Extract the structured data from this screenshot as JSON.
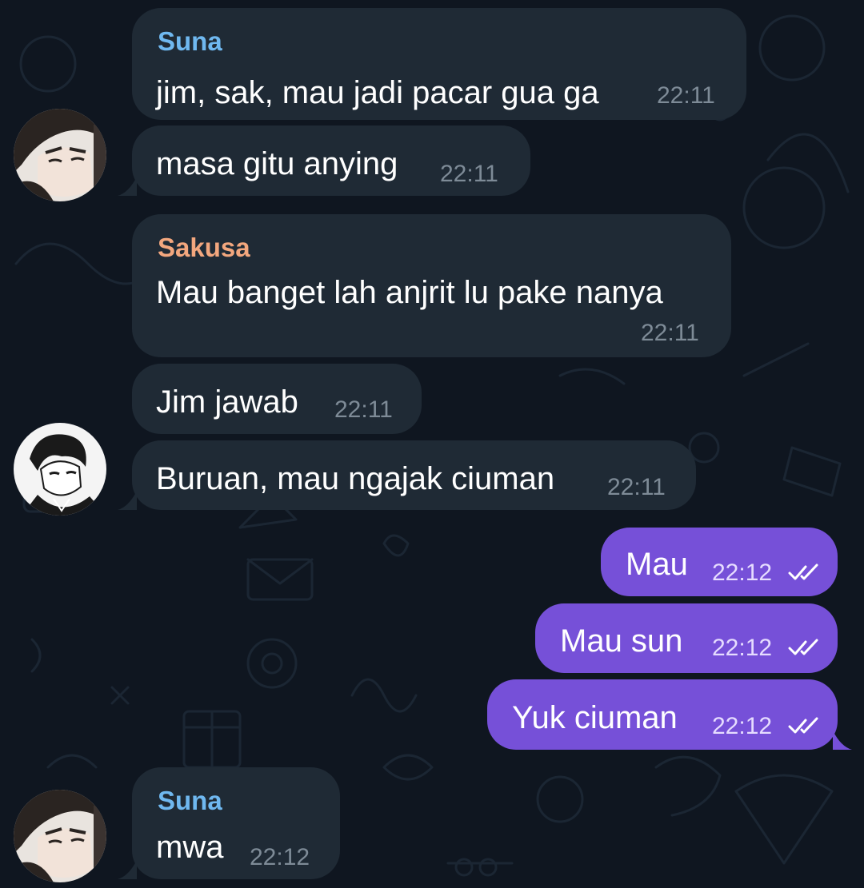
{
  "colors": {
    "background": "#0f1620",
    "incoming_bubble": "#1f2a35",
    "outgoing_bubble": "#7650d8",
    "sender_suna": "#6fb8f0",
    "sender_sakusa": "#f3a77e",
    "time_incoming": "#7e8b97",
    "time_outgoing": "#e6dcff"
  },
  "icons": {
    "read_receipt": "double-check-icon",
    "avatar_suna": "avatar-suna",
    "avatar_sakusa": "avatar-sakusa"
  },
  "messages": [
    {
      "sender": "Suna",
      "text": "jim, sak, mau jadi pacar gua ga",
      "time": "22:11",
      "direction": "incoming"
    },
    {
      "text": "masa gitu anying",
      "time": "22:11",
      "direction": "incoming"
    },
    {
      "sender": "Sakusa",
      "text": "Mau banget lah anjrit lu pake nanya",
      "time": "22:11",
      "direction": "incoming"
    },
    {
      "text": "Jim jawab",
      "time": "22:11",
      "direction": "incoming"
    },
    {
      "text": "Buruan, mau ngajak ciuman",
      "time": "22:11",
      "direction": "incoming"
    },
    {
      "text": "Mau",
      "time": "22:12",
      "direction": "outgoing",
      "status": "read"
    },
    {
      "text": "Mau sun",
      "time": "22:12",
      "direction": "outgoing",
      "status": "read"
    },
    {
      "text": "Yuk ciuman",
      "time": "22:12",
      "direction": "outgoing",
      "status": "read"
    },
    {
      "sender": "Suna",
      "text": "mwa",
      "time": "22:12",
      "direction": "incoming"
    }
  ]
}
